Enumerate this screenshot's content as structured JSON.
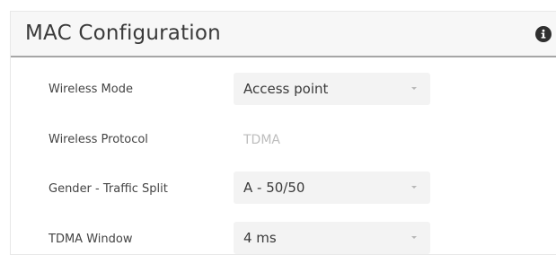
{
  "panel": {
    "title": "MAC Configuration",
    "info_icon": "info-icon"
  },
  "fields": {
    "wireless_mode": {
      "label": "Wireless Mode",
      "value": "Access point"
    },
    "wireless_protocol": {
      "label": "Wireless Protocol",
      "value": "TDMA"
    },
    "traffic_split": {
      "label": "Gender - Traffic Split",
      "value": "A - 50/50"
    },
    "tdma_window": {
      "label": "TDMA Window",
      "value": "4 ms"
    }
  },
  "colors": {
    "header_bg": "#f7f7f7",
    "header_border": "#a6a6a6",
    "select_bg": "#f3f3f3",
    "disabled_text": "#bdbdbd"
  }
}
